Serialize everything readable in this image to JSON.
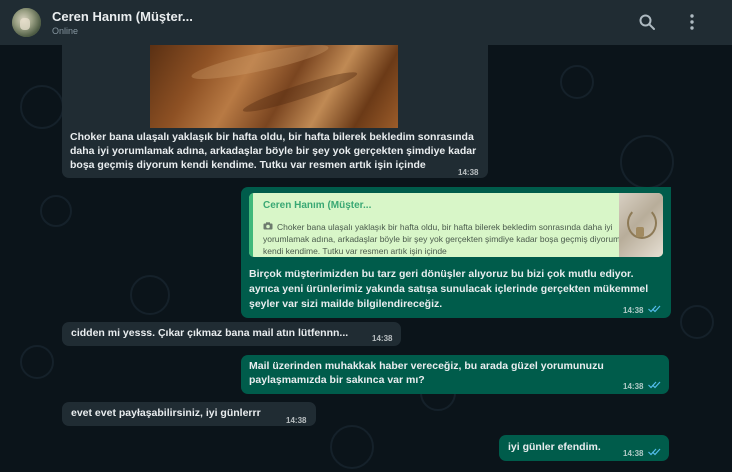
{
  "header": {
    "contact_name": "Ceren Hanım (Müşter...",
    "status": "Online",
    "search_icon": "search-icon",
    "menu_icon": "more-vert-icon"
  },
  "colors": {
    "header_bg": "#202c33",
    "chat_bg": "#0b141a",
    "incoming_bubble": "#202c33",
    "outgoing_bubble": "#005c4b",
    "read_tick": "#53bdeb"
  },
  "messages": [
    {
      "direction": "incoming",
      "has_image": true,
      "lines": [
        "Choker bana ulaşalı yaklaşık bir hafta oldu, bir hafta bilerek bekledim sonrasında",
        "daha iyi yorumlamak adına, arkadaşlar böyle bir şey yok gerçekten şimdiye kadar",
        "boşa geçmiş diyorum kendi kendime. Tutku var resmen artık işin içinde"
      ],
      "time": "14:38"
    },
    {
      "direction": "outgoing",
      "quote": {
        "name": "Ceren Hanım (Müşter...",
        "lines": [
          "Choker bana ulaşalı yaklaşık bir hafta oldu, bir hafta bilerek bekledim sonrasında daha iyi",
          "yorumlamak adına, arkadaşlar böyle bir şey yok gerçekten şimdiye kadar boşa geçmiş diyorum",
          "kendi kendime. Tutku var resmen artık işin içinde"
        ]
      },
      "lines": [
        "Birçok müşterimizden bu tarz geri dönüşler alıyoruz bu bizi çok mutlu ediyor.",
        "ayrıca yeni ürünlerimiz yakında satışa sunulacak içlerinde gerçekten mükemmel",
        "şeyler var sizi mailde bilgilendireceğiz."
      ],
      "time": "14:38"
    },
    {
      "direction": "incoming",
      "lines": [
        "cidden mi yesss. Çıkar çıkmaz bana mail atın lütfennn..."
      ],
      "time": "14:38"
    },
    {
      "direction": "outgoing",
      "lines": [
        "Mail üzerinden muhakkak haber vereceğiz, bu arada güzel yorumunuzu",
        "paylaşmamızda bir sakınca var mı?"
      ],
      "time": "14:38"
    },
    {
      "direction": "incoming",
      "lines": [
        "evet evet payłaşabilirsiniz, iyi günlerrr"
      ],
      "time": "14:38"
    },
    {
      "direction": "outgoing",
      "lines": [
        "iyi günler efendim."
      ],
      "time": "14:38"
    }
  ]
}
